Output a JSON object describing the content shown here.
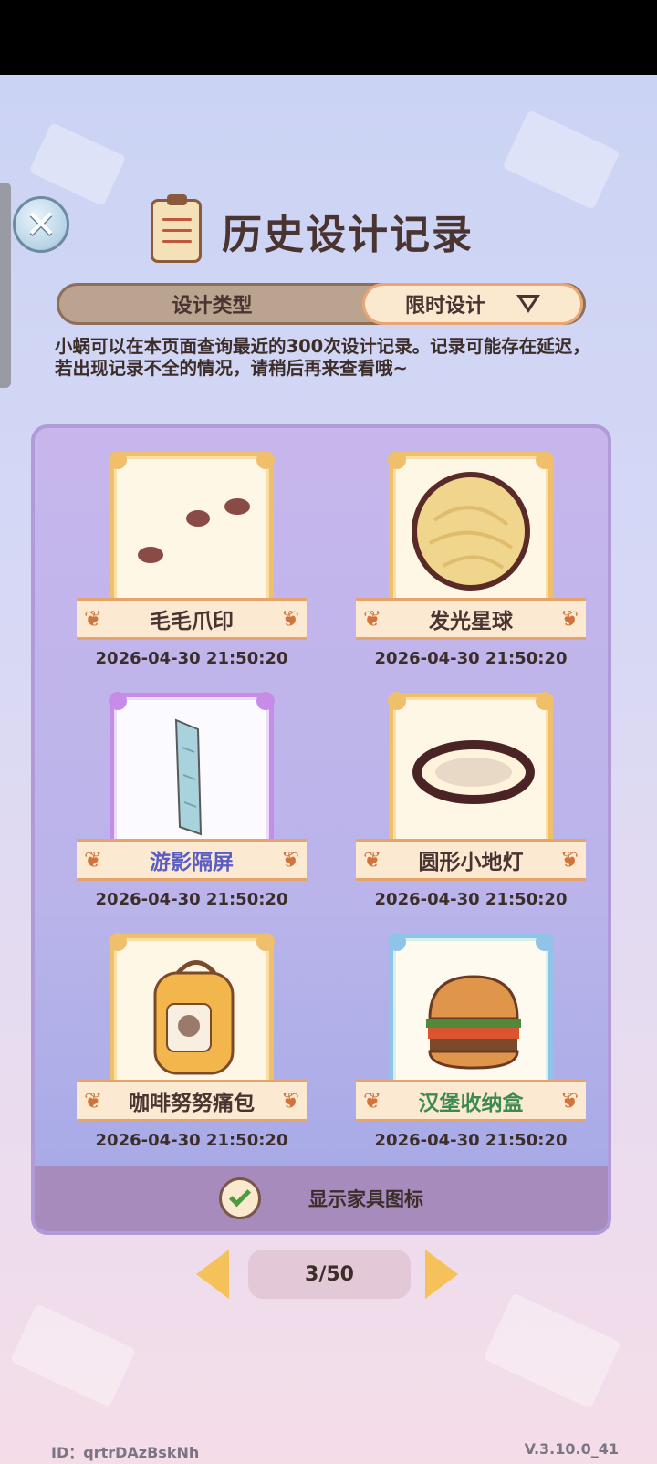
{
  "header": {
    "title": "历史设计记录"
  },
  "type_filter": {
    "label": "设计类型",
    "selected": "限时设计"
  },
  "notice": "小蜗可以在本页面查询最近的300次设计记录。记录可能存在延迟，若出现记录不全的情况，请稍后再来查看哦~",
  "records": [
    {
      "name": "毛毛爪印",
      "date": "2026-04-30 21:50:20",
      "item_icon": "paw-print-icon"
    },
    {
      "name": "发光星球",
      "date": "2026-04-30 21:50:20",
      "item_icon": "glowing-planet-icon"
    },
    {
      "name": "游影隔屏",
      "date": "2026-04-30 21:50:20",
      "item_icon": "folding-screen-icon"
    },
    {
      "name": "圆形小地灯",
      "date": "2026-04-30 21:50:20",
      "item_icon": "round-floor-lamp-icon"
    },
    {
      "name": "咖啡努努痛包",
      "date": "2026-04-30 21:50:20",
      "item_icon": "backpack-icon"
    },
    {
      "name": "汉堡收纳盒",
      "date": "2026-04-30 21:50:20",
      "item_icon": "burger-box-icon"
    }
  ],
  "footer": {
    "show_icons_label": "显示家具图标",
    "show_icons_checked": true
  },
  "pagination": {
    "indicator": "3/50",
    "current": 3,
    "total": 50
  },
  "meta": {
    "id_text": "ID：qrtrDAzBskNh",
    "version": "V.3.10.0_41"
  }
}
